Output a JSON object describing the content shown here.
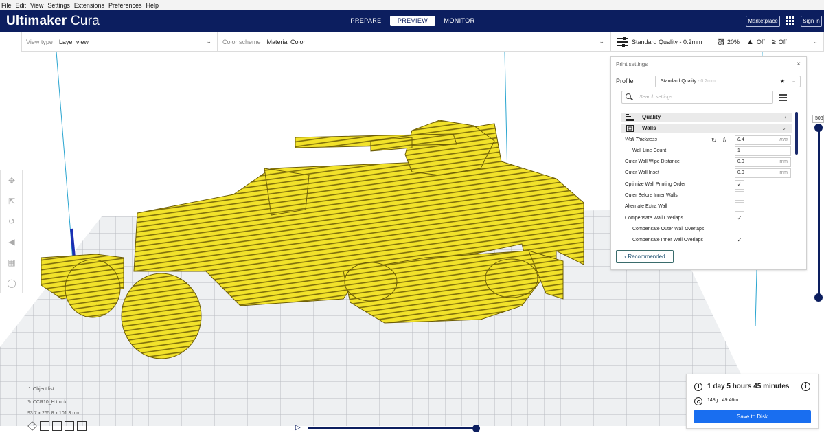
{
  "menu": [
    "File",
    "Edit",
    "View",
    "Settings",
    "Extensions",
    "Preferences",
    "Help"
  ],
  "brand": {
    "name_bold": "Ultimaker",
    "name_light": " Cura"
  },
  "stages": [
    "PREPARE",
    "PREVIEW",
    "MONITOR"
  ],
  "active_stage": "PREVIEW",
  "header_right": {
    "marketplace": "Marketplace",
    "signin": "Sign in"
  },
  "view_bar": {
    "view_type_label": "View type",
    "view_type_value": "Layer view",
    "color_scheme_label": "Color scheme",
    "color_scheme_value": "Material Color"
  },
  "print_bar": {
    "quality": "Standard Quality - 0.2mm",
    "infill": "20%",
    "support": "Off",
    "adhesion": "Off"
  },
  "settings_panel": {
    "title": "Print settings",
    "profile_label": "Profile",
    "profile_value": "Standard Quality",
    "profile_suffix": "- 0.2mm",
    "search_placeholder": "Search settings",
    "categories": [
      {
        "label": "Quality"
      },
      {
        "label": "Walls"
      }
    ],
    "rows": [
      {
        "label": "Wall Thickness",
        "value": "0.4",
        "unit": "mm"
      },
      {
        "label": "Wall Line Count",
        "value": "1"
      },
      {
        "label": "Outer Wall Wipe Distance",
        "value": "0.0",
        "unit": "mm"
      },
      {
        "label": "Outer Wall Inset",
        "value": "0.0",
        "unit": "mm"
      },
      {
        "label": "Optimize Wall Printing Order",
        "checked": "✓"
      },
      {
        "label": "Outer Before Inner Walls",
        "checked": ""
      },
      {
        "label": "Alternate Extra Wall",
        "checked": ""
      },
      {
        "label": "Compensate Wall Overlaps",
        "checked": "✓"
      },
      {
        "label": "Compensate Outer Wall Overlaps",
        "checked": ""
      },
      {
        "label": "Compensate Inner Wall Overlaps",
        "checked": "✓"
      }
    ],
    "recommended_label": "Recommended"
  },
  "layer_slider": {
    "value": "506"
  },
  "object_info": {
    "list_label": "Object list",
    "object_name": "CCR10_H truck",
    "dimensions": "93.7 x 265.8 x 101.3 mm"
  },
  "output": {
    "time": "1 day 5 hours 45 minutes",
    "material": "148g · 49.46m",
    "save_label": "Save to Disk"
  },
  "colors": {
    "header": "#0c1e5f",
    "accent": "#196ef0",
    "model": "#f2e22a"
  },
  "icons": [
    "search-icon",
    "menu-icon",
    "close-icon",
    "clock-icon",
    "info-icon",
    "spool-icon",
    "move-icon",
    "scale-icon",
    "rotate-icon",
    "mirror-icon",
    "per-model-settings-icon",
    "support-blocker-icon",
    "play-icon"
  ]
}
